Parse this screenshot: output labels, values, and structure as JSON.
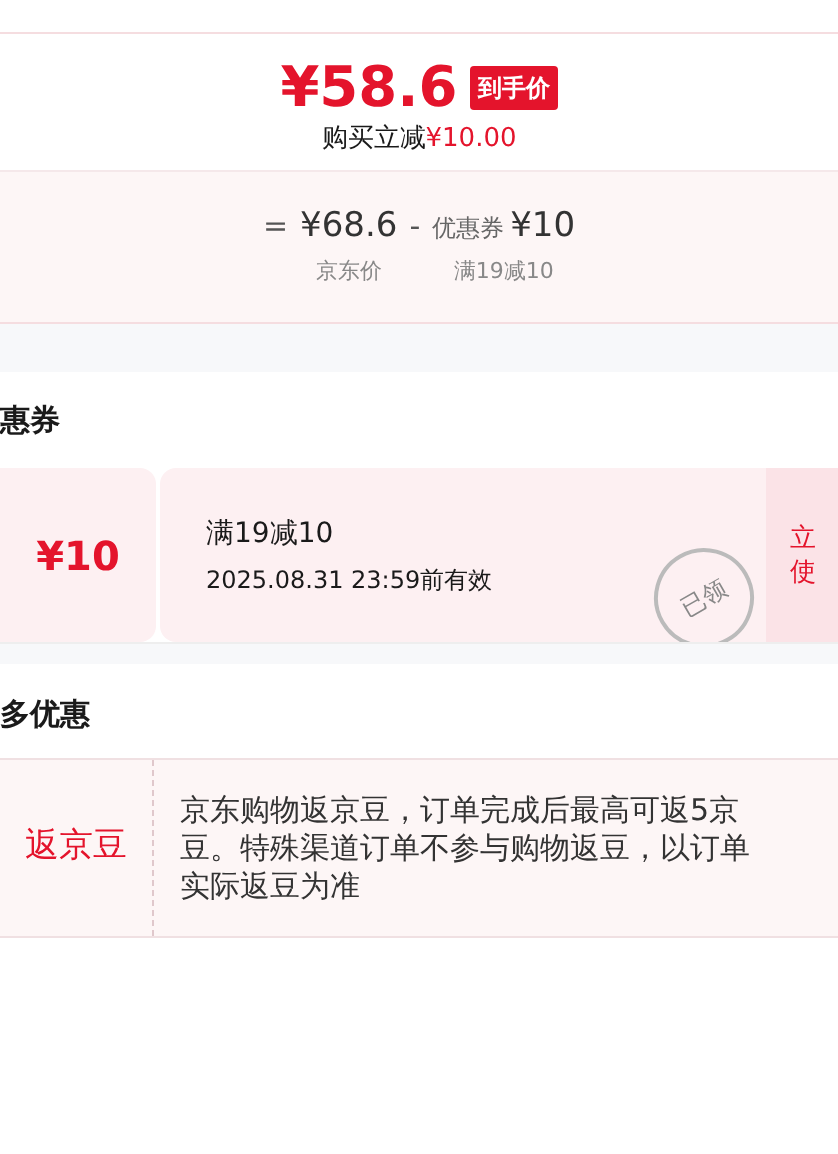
{
  "price": {
    "amount": "¥58.6",
    "badge": "到手价",
    "discount_label": "购买立减",
    "discount_value": "¥10.00"
  },
  "formula": {
    "equals": "=",
    "base_price": "¥68.6",
    "base_caption": "京东价",
    "minus": "-",
    "coupon_label": "优惠券",
    "coupon_value": "¥10",
    "coupon_caption": "满19减10"
  },
  "coupon_section": {
    "title": "惠券",
    "coupons": [
      {
        "value": "¥10",
        "condition": "满19减10",
        "validity": "2025.08.31 23:59前有效",
        "claimed": true,
        "stamp": "已领",
        "button_lines": [
          "立",
          "使"
        ]
      }
    ]
  },
  "more_section": {
    "title": "多优惠",
    "offers": [
      {
        "name": "返京豆",
        "description": "京东购物返京豆，订单完成后最高可返5京豆。特殊渠道订单不参与购物返豆，以订单实际返豆为准"
      }
    ]
  }
}
